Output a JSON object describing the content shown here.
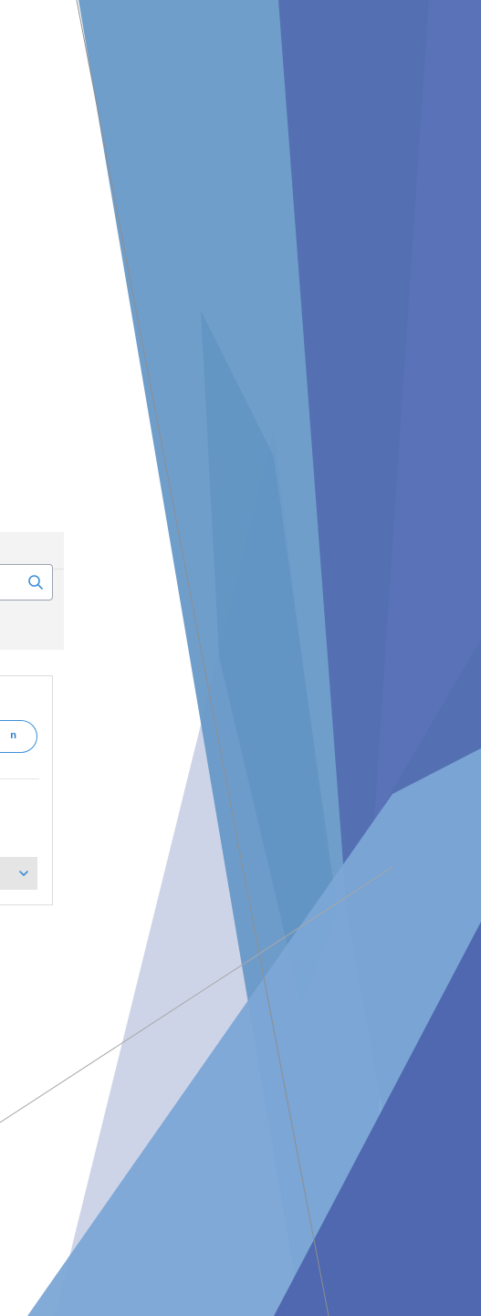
{
  "search": {
    "icon": "search-icon"
  },
  "card": {
    "action_button_label": "n",
    "dropdown_icon": "chevron-down-icon"
  },
  "theme": {
    "accent": "#3b8fd6",
    "decor_blue_1": "#6a9fd0",
    "decor_blue_2": "#4f6fb5",
    "decor_lavender": "#c9cfe5"
  }
}
